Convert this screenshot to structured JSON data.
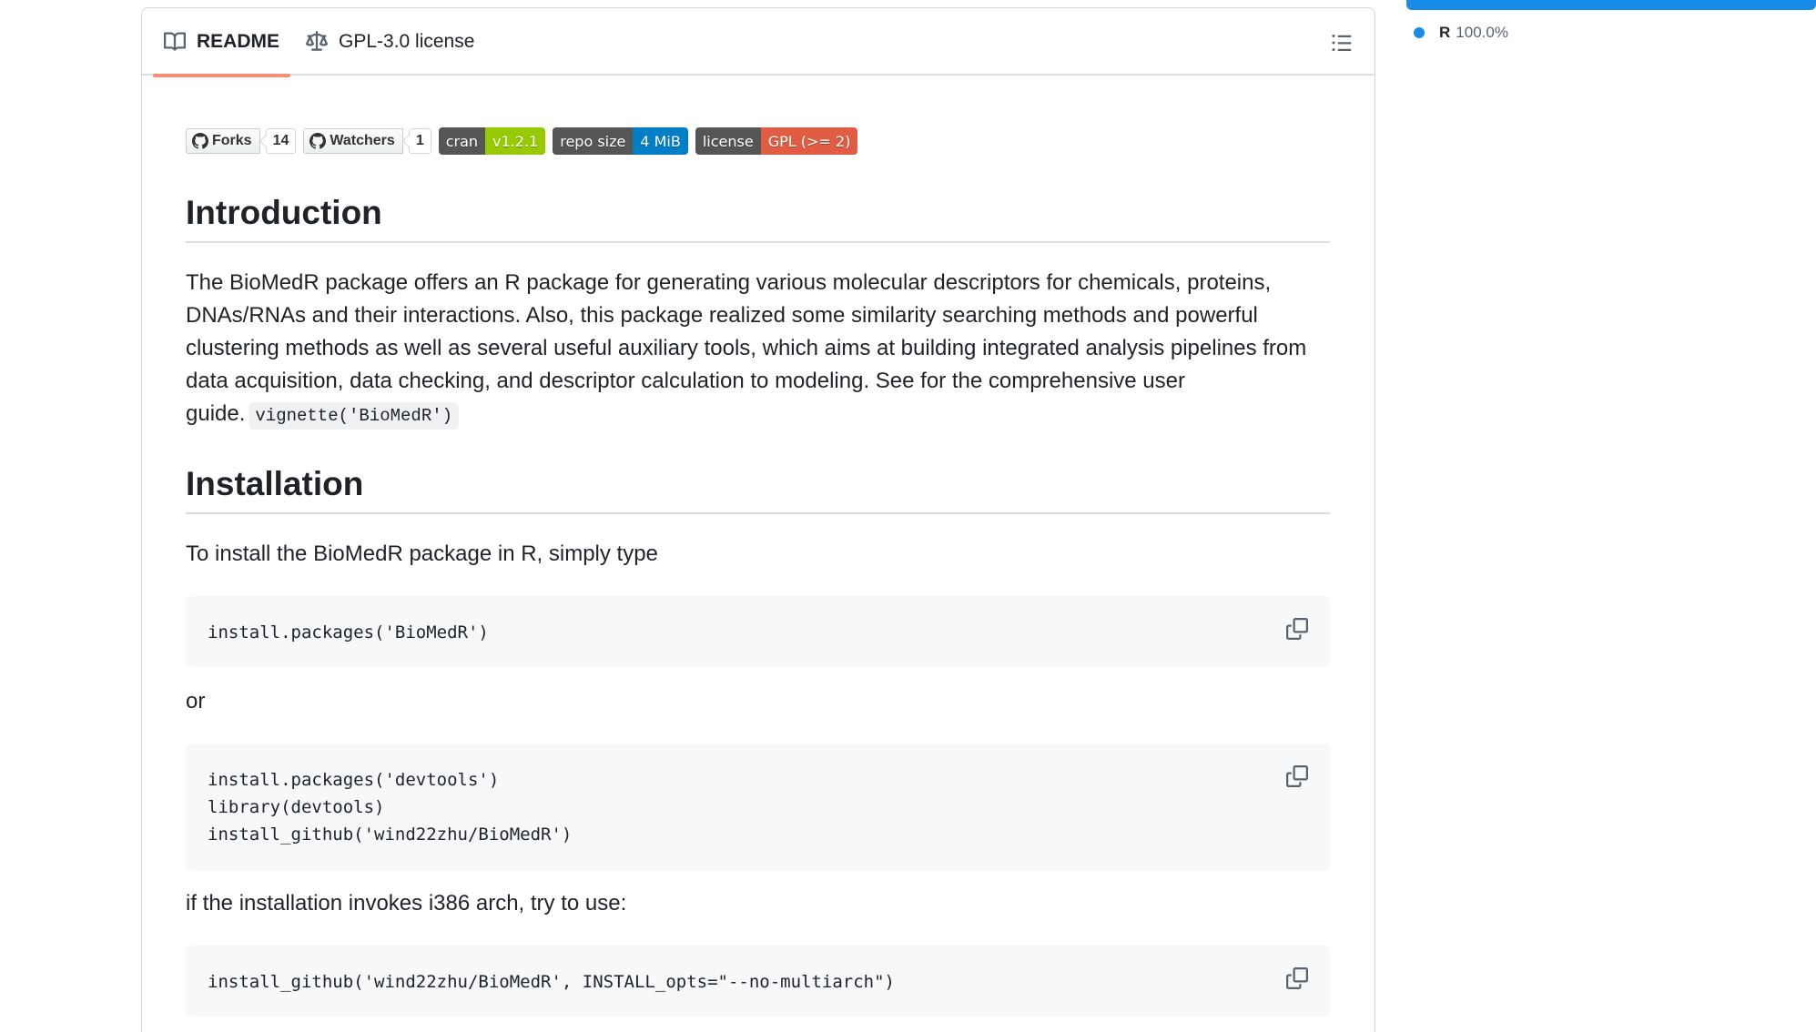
{
  "tabs": {
    "readme_label": "README",
    "license_label": "GPL-3.0 license"
  },
  "badges": {
    "forks": {
      "label": "Forks",
      "count": "14"
    },
    "watchers": {
      "label": "Watchers",
      "count": "1"
    },
    "cran": {
      "left": "cran",
      "right": "v1.2.1",
      "right_color": "#97ca00"
    },
    "repo_size": {
      "left": "repo size",
      "right": "4 MiB",
      "right_color": "#007ec6"
    },
    "license": {
      "left": "license",
      "right": "GPL (>= 2)",
      "right_color": "#e05d44"
    }
  },
  "readme": {
    "intro_heading": "Introduction",
    "intro_text": "The BioMedR package offers an R package for generating various molecular descriptors for chemicals, proteins, DNAs/RNAs and their interactions. Also, this package realized some similarity searching methods and powerful clustering methods as well as several useful auxiliary tools, which aims at building integrated analysis pipelines from data acquisition, data checking, and descriptor calculation to modeling. See for the comprehensive user guide.",
    "intro_code": "vignette('BioMedR')",
    "install_heading": "Installation",
    "install_text": "To install the BioMedR package in R, simply type",
    "code1": [
      "install.packages('BioMedR')"
    ],
    "or_text": "or",
    "code2": [
      "install.packages('devtools')",
      "library(devtools)",
      "install_github('wind22zhu/BioMedR')"
    ],
    "i386_text": "if the installation invokes i386 arch, try to use:",
    "code3": [
      "install_github('wind22zhu/BioMedR', INSTALL_opts=\"--no-multiarch\")"
    ]
  },
  "sidebar": {
    "languages": [
      {
        "name": "R",
        "percent": "100.0%",
        "color": "#198ce7"
      }
    ]
  }
}
